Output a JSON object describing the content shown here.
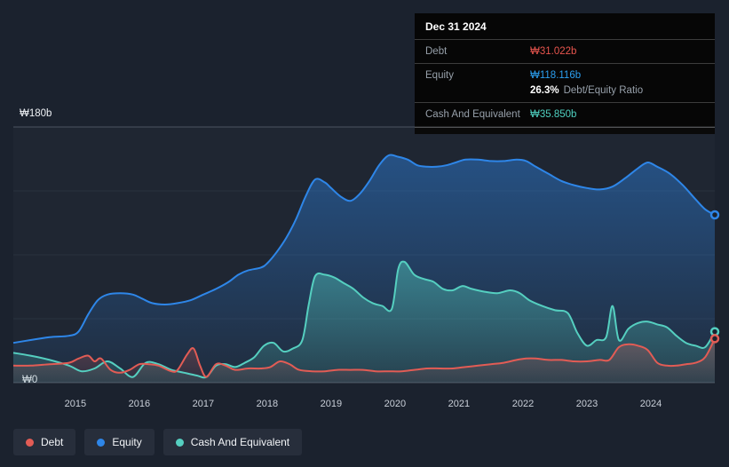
{
  "tooltip": {
    "date": "Dec 31 2024",
    "debt_label": "Debt",
    "debt_value": "₩31.022b",
    "equity_label": "Equity",
    "equity_value": "₩118.116b",
    "ratio_value": "26.3%",
    "ratio_label": "Debt/Equity Ratio",
    "cash_label": "Cash And Equivalent",
    "cash_value": "₩35.850b"
  },
  "axis": {
    "y_top_label": "₩180b",
    "y_bottom_label": "₩0"
  },
  "legend": [
    {
      "label": "Debt",
      "color": "#e25c55"
    },
    {
      "label": "Equity",
      "color": "#2e86e8"
    },
    {
      "label": "Cash And Equivalent",
      "color": "#55cfc0"
    }
  ],
  "chart_data": {
    "type": "area",
    "title": "Debt, Equity and Cash history",
    "y_unit": "₩ billions",
    "x_range": [
      2014.03,
      2025.0
    ],
    "y_range": [
      0,
      180
    ],
    "y_gridlines": [
      0,
      45,
      90,
      135,
      180
    ],
    "x_ticks": [
      2015,
      2016,
      2017,
      2018,
      2019,
      2020,
      2021,
      2022,
      2023,
      2024
    ],
    "legend_position": "bottom-left",
    "series": [
      {
        "name": "Equity",
        "color": "#2e86e8",
        "fill_opacity_top": 0.45,
        "fill_opacity_bottom": 0.06,
        "points": [
          [
            2014.03,
            28
          ],
          [
            2014.3,
            30
          ],
          [
            2014.6,
            32
          ],
          [
            2014.9,
            33
          ],
          [
            2015.05,
            36
          ],
          [
            2015.2,
            48
          ],
          [
            2015.35,
            58
          ],
          [
            2015.5,
            62
          ],
          [
            2015.7,
            63
          ],
          [
            2015.9,
            62
          ],
          [
            2016.05,
            59
          ],
          [
            2016.2,
            56
          ],
          [
            2016.4,
            55
          ],
          [
            2016.6,
            56
          ],
          [
            2016.8,
            58
          ],
          [
            2017.0,
            62
          ],
          [
            2017.2,
            66
          ],
          [
            2017.4,
            71
          ],
          [
            2017.55,
            76
          ],
          [
            2017.7,
            79
          ],
          [
            2017.9,
            81
          ],
          [
            2018.0,
            84
          ],
          [
            2018.15,
            92
          ],
          [
            2018.3,
            102
          ],
          [
            2018.45,
            115
          ],
          [
            2018.6,
            131
          ],
          [
            2018.75,
            143
          ],
          [
            2018.9,
            141
          ],
          [
            2019.0,
            137
          ],
          [
            2019.15,
            131
          ],
          [
            2019.3,
            128
          ],
          [
            2019.45,
            133
          ],
          [
            2019.6,
            142
          ],
          [
            2019.75,
            153
          ],
          [
            2019.9,
            160
          ],
          [
            2020.05,
            159
          ],
          [
            2020.2,
            157
          ],
          [
            2020.35,
            153
          ],
          [
            2020.5,
            152
          ],
          [
            2020.65,
            152
          ],
          [
            2020.8,
            153
          ],
          [
            2020.95,
            155
          ],
          [
            2021.1,
            157
          ],
          [
            2021.3,
            157
          ],
          [
            2021.5,
            156
          ],
          [
            2021.7,
            156
          ],
          [
            2021.9,
            157
          ],
          [
            2022.05,
            156
          ],
          [
            2022.2,
            152
          ],
          [
            2022.4,
            147
          ],
          [
            2022.6,
            142
          ],
          [
            2022.8,
            139
          ],
          [
            2023.0,
            137
          ],
          [
            2023.2,
            136
          ],
          [
            2023.4,
            138
          ],
          [
            2023.6,
            144
          ],
          [
            2023.8,
            151
          ],
          [
            2023.95,
            155
          ],
          [
            2024.1,
            152
          ],
          [
            2024.3,
            147
          ],
          [
            2024.5,
            139
          ],
          [
            2024.7,
            129
          ],
          [
            2024.85,
            122
          ],
          [
            2025.0,
            118.116
          ]
        ]
      },
      {
        "name": "Cash And Equivalent",
        "color": "#55cfc0",
        "fill_opacity_top": 0.45,
        "fill_opacity_bottom": 0.12,
        "points": [
          [
            2014.03,
            21
          ],
          [
            2014.3,
            19
          ],
          [
            2014.6,
            16
          ],
          [
            2014.9,
            12
          ],
          [
            2015.1,
            8
          ],
          [
            2015.3,
            10
          ],
          [
            2015.5,
            15
          ],
          [
            2015.7,
            10
          ],
          [
            2015.9,
            4
          ],
          [
            2016.1,
            14
          ],
          [
            2016.3,
            13
          ],
          [
            2016.5,
            9
          ],
          [
            2016.7,
            7
          ],
          [
            2016.9,
            5
          ],
          [
            2017.05,
            4
          ],
          [
            2017.2,
            12
          ],
          [
            2017.35,
            13
          ],
          [
            2017.5,
            11
          ],
          [
            2017.65,
            14
          ],
          [
            2017.8,
            18
          ],
          [
            2017.95,
            26
          ],
          [
            2018.1,
            28
          ],
          [
            2018.25,
            22
          ],
          [
            2018.4,
            24
          ],
          [
            2018.55,
            30
          ],
          [
            2018.65,
            55
          ],
          [
            2018.75,
            75
          ],
          [
            2018.9,
            76
          ],
          [
            2019.05,
            74
          ],
          [
            2019.2,
            70
          ],
          [
            2019.35,
            66
          ],
          [
            2019.5,
            60
          ],
          [
            2019.65,
            56
          ],
          [
            2019.8,
            54
          ],
          [
            2019.95,
            52
          ],
          [
            2020.05,
            80
          ],
          [
            2020.15,
            85
          ],
          [
            2020.3,
            76
          ],
          [
            2020.45,
            73
          ],
          [
            2020.6,
            71
          ],
          [
            2020.75,
            66
          ],
          [
            2020.9,
            65
          ],
          [
            2021.05,
            68
          ],
          [
            2021.2,
            66
          ],
          [
            2021.4,
            64
          ],
          [
            2021.6,
            63
          ],
          [
            2021.8,
            65
          ],
          [
            2021.95,
            63
          ],
          [
            2022.1,
            58
          ],
          [
            2022.3,
            54
          ],
          [
            2022.5,
            51
          ],
          [
            2022.7,
            49
          ],
          [
            2022.85,
            35
          ],
          [
            2023.0,
            26
          ],
          [
            2023.15,
            30
          ],
          [
            2023.3,
            32
          ],
          [
            2023.4,
            54
          ],
          [
            2023.5,
            30
          ],
          [
            2023.65,
            38
          ],
          [
            2023.8,
            42
          ],
          [
            2023.95,
            43
          ],
          [
            2024.1,
            41
          ],
          [
            2024.25,
            39
          ],
          [
            2024.4,
            33
          ],
          [
            2024.55,
            28
          ],
          [
            2024.7,
            26
          ],
          [
            2024.85,
            25
          ],
          [
            2025.0,
            35.85
          ]
        ]
      },
      {
        "name": "Debt",
        "color": "#e25c55",
        "fill_opacity_top": 0.3,
        "fill_opacity_bottom": 0.06,
        "points": [
          [
            2014.03,
            12
          ],
          [
            2014.3,
            12
          ],
          [
            2014.6,
            13
          ],
          [
            2014.9,
            14
          ],
          [
            2015.05,
            17
          ],
          [
            2015.2,
            19
          ],
          [
            2015.3,
            15
          ],
          [
            2015.4,
            17
          ],
          [
            2015.55,
            9
          ],
          [
            2015.7,
            7
          ],
          [
            2015.85,
            9
          ],
          [
            2016.0,
            13
          ],
          [
            2016.15,
            13
          ],
          [
            2016.3,
            12
          ],
          [
            2016.5,
            8
          ],
          [
            2016.6,
            9
          ],
          [
            2016.75,
            20
          ],
          [
            2016.85,
            24
          ],
          [
            2016.95,
            12
          ],
          [
            2017.05,
            4
          ],
          [
            2017.2,
            13
          ],
          [
            2017.35,
            12
          ],
          [
            2017.5,
            9
          ],
          [
            2017.7,
            10
          ],
          [
            2017.9,
            10
          ],
          [
            2018.05,
            11
          ],
          [
            2018.2,
            15
          ],
          [
            2018.35,
            13
          ],
          [
            2018.5,
            9
          ],
          [
            2018.7,
            8
          ],
          [
            2018.9,
            8
          ],
          [
            2019.1,
            9
          ],
          [
            2019.3,
            9
          ],
          [
            2019.5,
            9
          ],
          [
            2019.7,
            8
          ],
          [
            2019.9,
            8
          ],
          [
            2020.1,
            8
          ],
          [
            2020.3,
            9
          ],
          [
            2020.5,
            10
          ],
          [
            2020.7,
            10
          ],
          [
            2020.9,
            10
          ],
          [
            2021.1,
            11
          ],
          [
            2021.3,
            12
          ],
          [
            2021.5,
            13
          ],
          [
            2021.7,
            14
          ],
          [
            2021.9,
            16
          ],
          [
            2022.05,
            17
          ],
          [
            2022.2,
            17
          ],
          [
            2022.4,
            16
          ],
          [
            2022.6,
            16
          ],
          [
            2022.8,
            15
          ],
          [
            2023.0,
            15
          ],
          [
            2023.2,
            16
          ],
          [
            2023.35,
            16
          ],
          [
            2023.5,
            25
          ],
          [
            2023.65,
            27
          ],
          [
            2023.8,
            26
          ],
          [
            2023.95,
            23
          ],
          [
            2024.1,
            14
          ],
          [
            2024.25,
            12
          ],
          [
            2024.4,
            12
          ],
          [
            2024.55,
            13
          ],
          [
            2024.7,
            14
          ],
          [
            2024.85,
            18
          ],
          [
            2025.0,
            31.022
          ]
        ]
      }
    ]
  }
}
